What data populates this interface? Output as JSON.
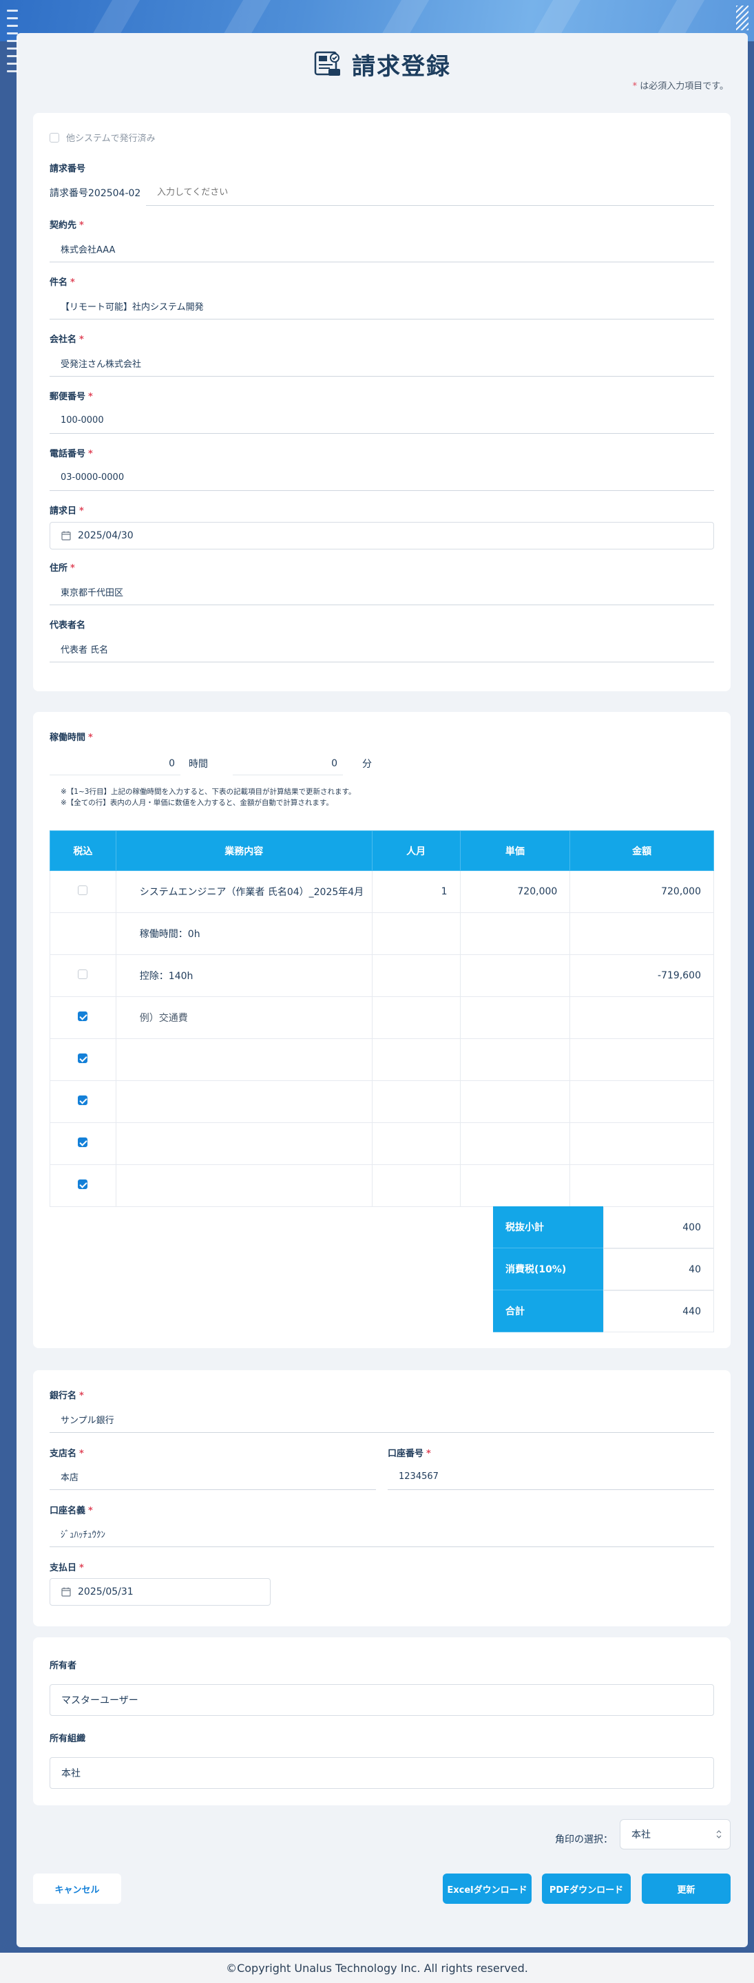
{
  "page": {
    "title": "請求登録",
    "required_note": "は必須入力項目です。",
    "required_mark": "*"
  },
  "basic": {
    "issued_checkbox_label": "他システムで発行済み",
    "invoice_no": {
      "label": "請求番号",
      "prefix": "請求番号202504-02",
      "placeholder": "入力してください"
    },
    "contractor": {
      "label": "契約先",
      "value": "株式会社AAA"
    },
    "subject": {
      "label": "件名",
      "value": "【リモート可能】社内システム開発"
    },
    "company": {
      "label": "会社名",
      "value": "受発注さん株式会社"
    },
    "postal": {
      "label": "郵便番号",
      "value": "100-0000"
    },
    "phone": {
      "label": "電話番号",
      "value": "03-0000-0000"
    },
    "invoice_date": {
      "label": "請求日",
      "value": "2025/04/30"
    },
    "address": {
      "label": "住所",
      "value": "東京都千代田区"
    },
    "representative": {
      "label": "代表者名",
      "value": "代表者 氏名"
    }
  },
  "work": {
    "label": "稼働時間",
    "hours": "0",
    "hours_unit": "時間",
    "minutes": "0",
    "minutes_unit": "分",
    "note1": "※【1~3行目】上記の稼働時間を入力すると、下表の記載項目が計算結果で更新されます。",
    "note2": "※【全ての行】表内の人月・単価に数値を入力すると、金額が自動で計算されます。"
  },
  "table": {
    "headers": [
      "税込",
      "業務内容",
      "人月",
      "単価",
      "金額"
    ],
    "rows": [
      {
        "checkbox": "unchecked",
        "desc": "システムエンジニア（作業者 氏名04）_2025年4月",
        "qty": "1",
        "price": "720,000",
        "amount": "720,000"
      },
      {
        "checkbox": "none",
        "desc": "稼働時間：0h",
        "qty": "",
        "price": "",
        "amount": ""
      },
      {
        "checkbox": "unchecked",
        "desc": "控除：140h",
        "qty": "",
        "price": "",
        "amount": "-719,600"
      },
      {
        "checkbox": "checked",
        "desc": "例）交通費",
        "qty": "",
        "price": "",
        "amount": ""
      },
      {
        "checkbox": "checked",
        "desc": "",
        "qty": "",
        "price": "",
        "amount": ""
      },
      {
        "checkbox": "checked",
        "desc": "",
        "qty": "",
        "price": "",
        "amount": ""
      },
      {
        "checkbox": "checked",
        "desc": "",
        "qty": "",
        "price": "",
        "amount": ""
      },
      {
        "checkbox": "checked",
        "desc": "",
        "qty": "",
        "price": "",
        "amount": ""
      }
    ],
    "subtotal_label": "税抜小計",
    "subtotal": "400",
    "tax_label": "消費税(10%)",
    "tax": "40",
    "total_label": "合計",
    "total": "440"
  },
  "bank": {
    "bank_name": {
      "label": "銀行名",
      "value": "サンプル銀行"
    },
    "branch": {
      "label": "支店名",
      "value": "本店"
    },
    "account_no": {
      "label": "口座番号",
      "value": "1234567"
    },
    "account_name": {
      "label": "口座名義",
      "value": "ｼﾞｭﾊｯﾁｭｳｸﾝ"
    },
    "pay_date": {
      "label": "支払日",
      "value": "2025/05/31"
    }
  },
  "owner": {
    "owner": {
      "label": "所有者",
      "value": "マスターユーザー"
    },
    "org": {
      "label": "所有組織",
      "value": "本社"
    }
  },
  "stamp": {
    "label": "角印の選択：",
    "value": "本社"
  },
  "buttons": {
    "cancel": "キャンセル",
    "excel": "Excelダウンロード",
    "pdf": "PDFダウンロード",
    "update": "更新"
  },
  "footer": {
    "copyright": "©Copyright Unalus Technology Inc. All rights reserved."
  },
  "colors": {
    "accent": "#13a6e8",
    "required": "#e0485b",
    "background": "#3a5f9a"
  }
}
